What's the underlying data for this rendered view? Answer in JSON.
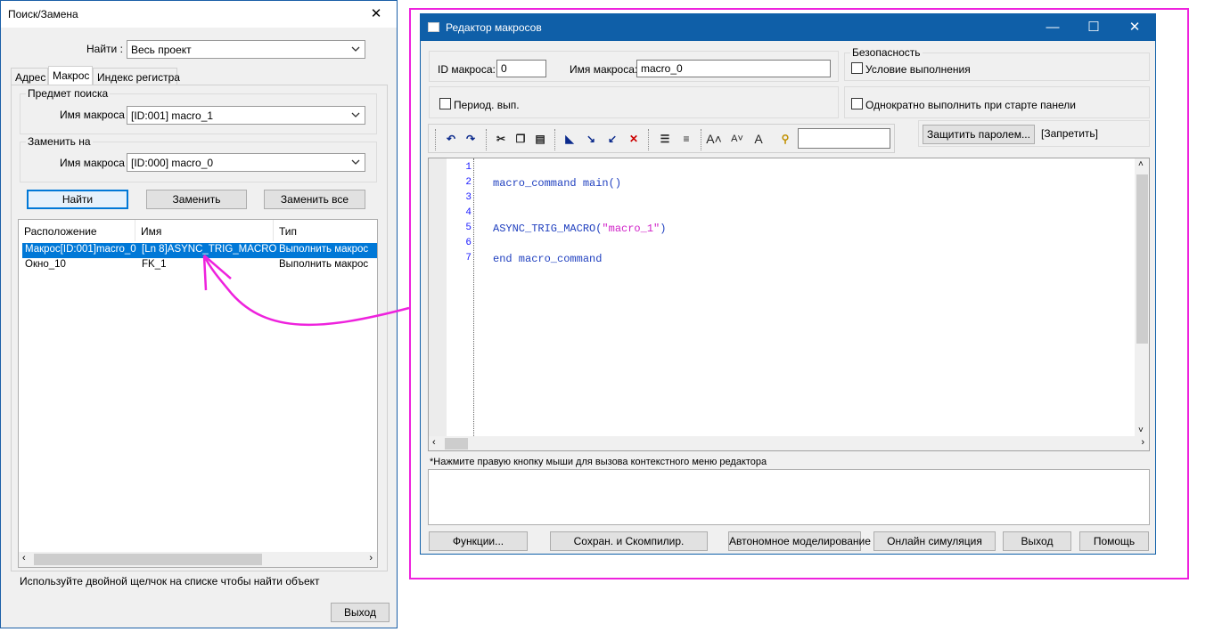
{
  "search_window": {
    "title": "Поиск/Замена",
    "find_label": "Найти :",
    "find_scope": "Весь проект",
    "tabs": [
      "Адрес",
      "Макрос",
      "Индекс регистра"
    ],
    "active_tab": 1,
    "search_subject": {
      "title": "Предмет поиска",
      "label": "Имя макроса :",
      "value": "[ID:001] macro_1"
    },
    "replace_with": {
      "title": "Заменить на",
      "label": "Имя макроса :",
      "value": "[ID:000] macro_0"
    },
    "buttons": {
      "find": "Найти",
      "replace": "Заменить",
      "replace_all": "Заменить все",
      "exit": "Выход"
    },
    "results": {
      "columns": [
        "Расположение",
        "Имя",
        "Тип"
      ],
      "rows": [
        {
          "location": "Макрос[ID:001]macro_0",
          "name": "[Ln 8]ASYNC_TRIG_MACRO",
          "type": "Выполнить макрос",
          "selected": true
        },
        {
          "location": "Окно_10",
          "name": "FK_1",
          "type": "Выполнить макрос",
          "selected": false
        }
      ]
    },
    "hint": "Используйте двойной щелчок на списке чтобы найти объект"
  },
  "macro_editor": {
    "title": "Редактор макросов",
    "id_label": "ID макроса:",
    "id_value": "0",
    "name_label": "Имя макроса:",
    "name_value": "macro_0",
    "security_title": "Безопасность",
    "condition_label": "Условие выполнения",
    "periodic_label": "Период. вып.",
    "run_once_label": "Однократно выполнить при старте панели",
    "protect_button": "Защитить паролем...",
    "forbid_label": "[Запретить]",
    "code_lines": [
      {
        "n": "1",
        "text": ""
      },
      {
        "n": "2",
        "text": "macro_command main()"
      },
      {
        "n": "3",
        "text": ""
      },
      {
        "n": "4",
        "text": ""
      },
      {
        "n": "5",
        "fn": "ASYNC_TRIG_MACRO(",
        "str": "\"macro_1\"",
        "tail": ")"
      },
      {
        "n": "6",
        "text": ""
      },
      {
        "n": "7",
        "text": "end macro_command"
      }
    ],
    "context_hint": "*Нажмите правую кнопку мыши для вызова контекстного меню редактора",
    "buttons": {
      "functions": "Функции...",
      "save_compile": "Сохран. и Скомпилир.",
      "offline_sim": "Автономное моделирование",
      "online_sim": "Онлайн симуляция",
      "exit": "Выход",
      "help": "Помощь"
    }
  },
  "colors": {
    "accent": "#0078d7",
    "title_blue": "#0f5fa8",
    "annotation": "#ee22dd"
  }
}
